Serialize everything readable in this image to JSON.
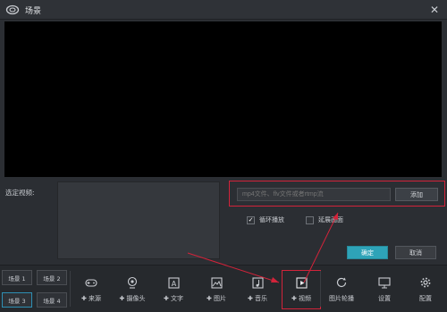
{
  "window": {
    "title": "场景",
    "close_icon": "close-icon",
    "logo_icon": "cloud-logo-icon"
  },
  "source": {
    "label": "选定视频:",
    "input_placeholder": "mp4文件、flv文件或者rtmp流",
    "add_label": "添加"
  },
  "options": {
    "loop_label": "循环播放",
    "loop_checked": true,
    "extend_label": "延展画面",
    "extend_checked": false
  },
  "actions": {
    "ok_label": "确定",
    "cancel_label": "取消"
  },
  "scenes": [
    "场景 1",
    "场景 2",
    "场景 3",
    "场景 4"
  ],
  "tools": [
    {
      "label": "✚ 来源",
      "icon": "gamepad-icon"
    },
    {
      "label": "✚ 摄像头",
      "icon": "webcam-icon"
    },
    {
      "label": "✚ 文字",
      "icon": "text-icon"
    },
    {
      "label": "✚ 图片",
      "icon": "image-icon"
    },
    {
      "label": "✚ 音乐",
      "icon": "music-icon"
    },
    {
      "label": "✚ 视频",
      "icon": "video-icon"
    },
    {
      "label": "图片轮播",
      "icon": "refresh-icon"
    },
    {
      "label": "设置",
      "icon": "desktop-icon"
    },
    {
      "label": "配置",
      "icon": "gear-icon"
    }
  ],
  "colors": {
    "accent": "#2ea3b8",
    "highlight": "#d2233a"
  }
}
